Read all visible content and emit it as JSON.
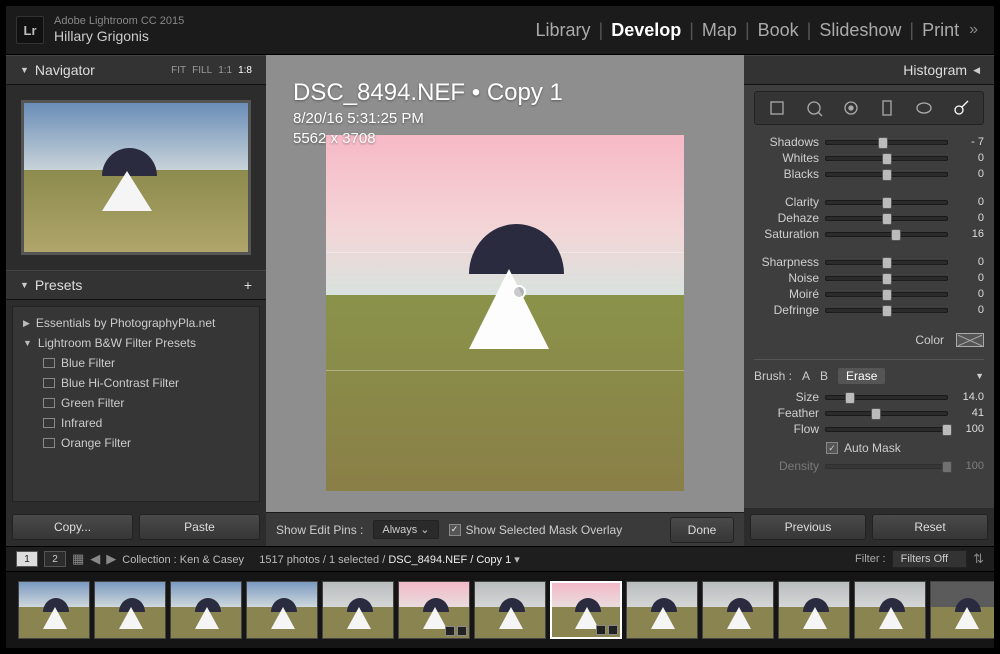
{
  "header": {
    "app_name": "Adobe Lightroom CC 2015",
    "user_name": "Hillary Grigonis",
    "logo_text": "Lr",
    "modules": [
      "Library",
      "Develop",
      "Map",
      "Book",
      "Slideshow",
      "Print"
    ],
    "active_module": "Develop"
  },
  "navigator": {
    "title": "Navigator",
    "options": [
      "FIT",
      "FILL",
      "1:1",
      "1:8"
    ],
    "active_option": "1:8"
  },
  "presets": {
    "title": "Presets",
    "folders": [
      {
        "name": "Essentials by PhotographyPla.net",
        "open": false
      },
      {
        "name": "Lightroom B&W Filter Presets",
        "open": true,
        "items": [
          "Blue Filter",
          "Blue Hi-Contrast Filter",
          "Green Filter",
          "Infrared",
          "Orange Filter"
        ]
      }
    ],
    "copy_btn": "Copy...",
    "paste_btn": "Paste"
  },
  "center": {
    "filename": "DSC_8494.NEF  •  Copy 1",
    "datetime": "8/20/16 5:31:25 PM",
    "dimensions": "5562 x 3708",
    "show_edit_pins_label": "Show Edit Pins :",
    "show_edit_pins_value": "Always",
    "show_mask_label": "Show Selected Mask Overlay",
    "done": "Done"
  },
  "right": {
    "histogram": "Histogram",
    "sliders": [
      {
        "name": "Shadows",
        "value": "- 7",
        "pos": 47
      },
      {
        "name": "Whites",
        "value": "0",
        "pos": 50
      },
      {
        "name": "Blacks",
        "value": "0",
        "pos": 50
      }
    ],
    "sliders2": [
      {
        "name": "Clarity",
        "value": "0",
        "pos": 50
      },
      {
        "name": "Dehaze",
        "value": "0",
        "pos": 50
      },
      {
        "name": "Saturation",
        "value": "16",
        "pos": 58,
        "sat": true
      }
    ],
    "sliders3": [
      {
        "name": "Sharpness",
        "value": "0",
        "pos": 50
      },
      {
        "name": "Noise",
        "value": "0",
        "pos": 50
      },
      {
        "name": "Moiré",
        "value": "0",
        "pos": 50
      },
      {
        "name": "Defringe",
        "value": "0",
        "pos": 50
      }
    ],
    "color_label": "Color",
    "brush": {
      "label": "Brush :",
      "a": "A",
      "b": "B",
      "erase": "Erase"
    },
    "brush_sliders": [
      {
        "name": "Size",
        "value": "14.0",
        "pos": 20
      },
      {
        "name": "Feather",
        "value": "41",
        "pos": 41
      },
      {
        "name": "Flow",
        "value": "100",
        "pos": 100
      }
    ],
    "automask": "Auto Mask",
    "density": {
      "name": "Density",
      "value": "100",
      "pos": 100
    },
    "previous": "Previous",
    "reset": "Reset"
  },
  "strip": {
    "pages": [
      "1",
      "2"
    ],
    "collection_label": "Collection :",
    "collection_name": "Ken & Casey",
    "count": "1517 photos / 1 selected /",
    "current": "DSC_8494.NEF / Copy 1",
    "filter_label": "Filter :",
    "filter_value": "Filters Off",
    "thumbs": [
      {
        "sky": "sky-blue"
      },
      {
        "sky": "sky-blue"
      },
      {
        "sky": "sky-blue"
      },
      {
        "sky": "sky-blue"
      },
      {
        "sky": "sky-gray"
      },
      {
        "sky": "sky-pink",
        "badge": true
      },
      {
        "sky": "sky-gray"
      },
      {
        "sky": "sky-pink",
        "badge": true,
        "selected": true
      },
      {
        "sky": "sky-gray"
      },
      {
        "sky": "sky-gray"
      },
      {
        "sky": "sky-gray"
      },
      {
        "sky": "sky-gray"
      },
      {
        "sky": "sky-dark"
      }
    ]
  }
}
